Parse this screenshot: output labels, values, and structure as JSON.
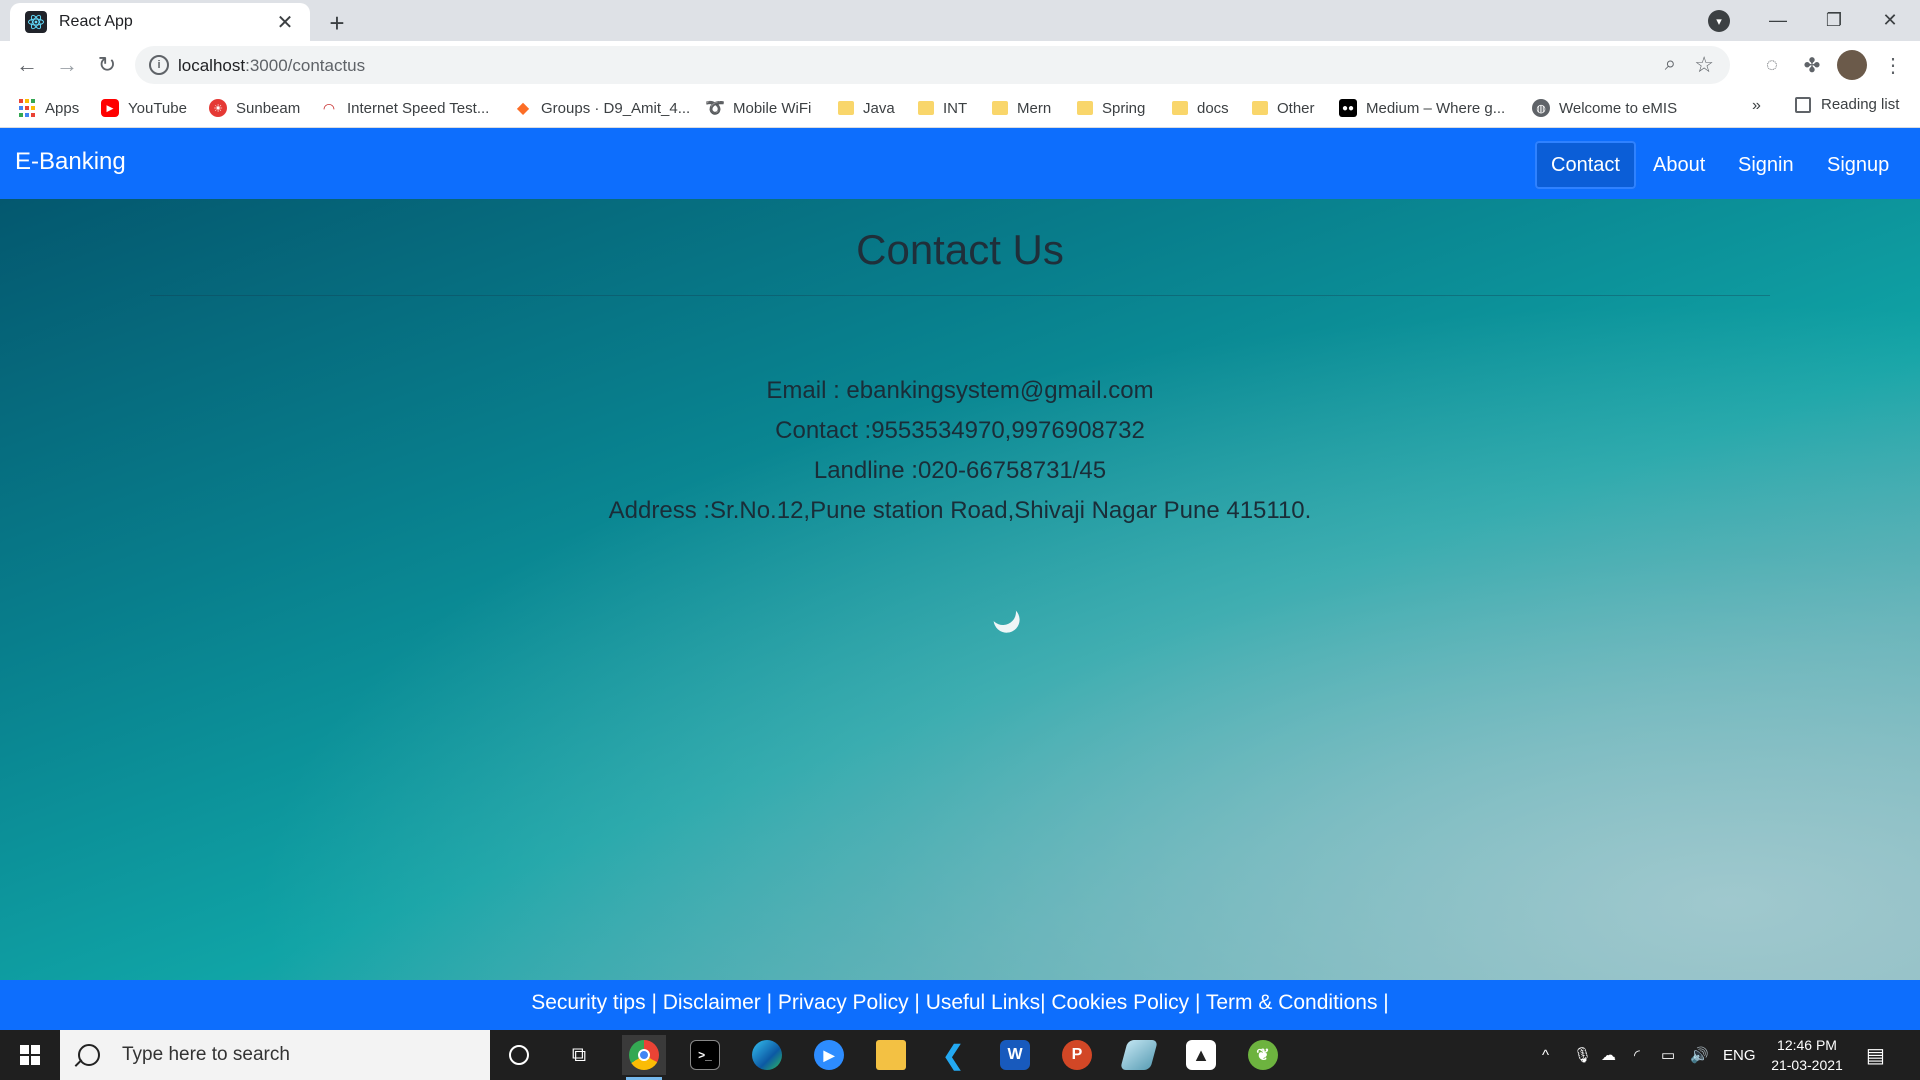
{
  "browser": {
    "tab_title": "React App",
    "tab_close": "✕",
    "new_tab": "+",
    "url_host": "localhost",
    "url_rest": ":3000/contactus",
    "window_controls": [
      "—",
      "❐",
      "✕"
    ],
    "bookmarks": [
      {
        "label": "Apps",
        "icon": "apps-grid-icon"
      },
      {
        "label": "YouTube",
        "icon": "youtube-icon"
      },
      {
        "label": "Sunbeam",
        "icon": "sunbeam-icon"
      },
      {
        "label": "Internet Speed Test...",
        "icon": "speedometer-icon"
      },
      {
        "label": "Groups · D9_Amit_4...",
        "icon": "gitlab-icon"
      },
      {
        "label": "Mobile WiFi",
        "icon": "airtel-icon"
      },
      {
        "label": "Java",
        "icon": "folder-icon"
      },
      {
        "label": "INT",
        "icon": "folder-icon"
      },
      {
        "label": "Mern",
        "icon": "folder-icon"
      },
      {
        "label": "Spring",
        "icon": "folder-icon"
      },
      {
        "label": "docs",
        "icon": "folder-icon"
      },
      {
        "label": "Other",
        "icon": "folder-icon"
      },
      {
        "label": "Medium – Where g...",
        "icon": "medium-icon"
      },
      {
        "label": "Welcome to eMIS",
        "icon": "globe-icon"
      }
    ],
    "bookmarks_more": "»",
    "reading_list": "Reading list"
  },
  "navbar": {
    "brand": "E-Banking",
    "links": [
      "Contact",
      "About",
      "Signin",
      "Signup"
    ],
    "active_index": 0
  },
  "contact": {
    "heading": "Contact Us",
    "email": "Email : ebankingsystem@gmail.com",
    "phone": "Contact :9553534970,9976908732",
    "landline": "Landline :020-66758731/45",
    "address": "Address :Sr.No.12,Pune station Road,Shivaji Nagar Pune 415110."
  },
  "footer": {
    "links": [
      "Security tips",
      "Disclaimer",
      "Privacy Policy",
      "Useful Links",
      "Cookies Policy",
      "Term & Conditions"
    ]
  },
  "taskbar": {
    "search_placeholder": "Type here to search",
    "language": "ENG",
    "time": "12:46 PM",
    "date": "21-03-2021"
  },
  "colors": {
    "navbar": "#0d6efd",
    "navbar_active": "#0b5ed7",
    "footer": "#0d6efd",
    "hero_start": "#04586f",
    "hero_end": "#79b0b8"
  }
}
